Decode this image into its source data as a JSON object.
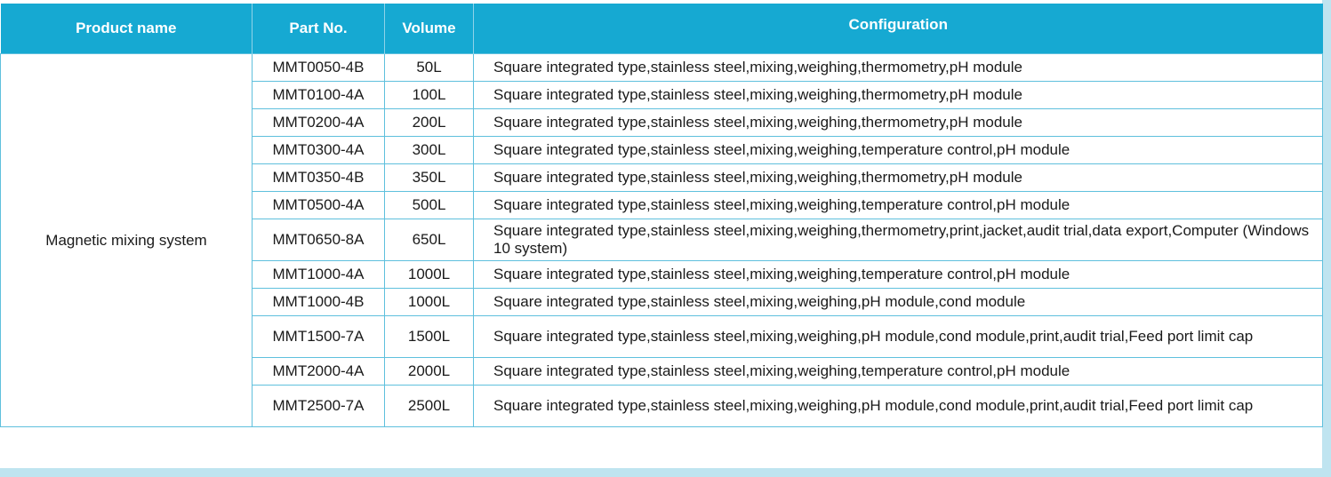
{
  "table": {
    "headers": [
      "Product name",
      "Part No.",
      "Volume",
      "Configuration"
    ],
    "product_name": "Magnetic mixing system",
    "rows": [
      {
        "part": "MMT0050-4B",
        "volume": "50L",
        "config": "Square integrated type,stainless steel,mixing,weighing,thermometry,pH module"
      },
      {
        "part": "MMT0100-4A",
        "volume": "100L",
        "config": "Square integrated type,stainless steel,mixing,weighing,thermometry,pH module"
      },
      {
        "part": "MMT0200-4A",
        "volume": "200L",
        "config": "Square integrated type,stainless steel,mixing,weighing,thermometry,pH module"
      },
      {
        "part": "MMT0300-4A",
        "volume": "300L",
        "config": "Square integrated type,stainless steel,mixing,weighing,temperature control,pH module"
      },
      {
        "part": "MMT0350-4B",
        "volume": "350L",
        "config": "Square integrated type,stainless steel,mixing,weighing,thermometry,pH module"
      },
      {
        "part": "MMT0500-4A",
        "volume": "500L",
        "config": "Square integrated type,stainless steel,mixing,weighing,temperature control,pH module"
      },
      {
        "part": "MMT0650-8A",
        "volume": "650L",
        "config": "Square integrated type,stainless steel,mixing,weighing,thermometry,print,jacket,audit trial,data export,Computer (Windows 10 system)"
      },
      {
        "part": "MMT1000-4A",
        "volume": "1000L",
        "config": "Square integrated type,stainless steel,mixing,weighing,temperature control,pH module"
      },
      {
        "part": "MMT1000-4B",
        "volume": "1000L",
        "config": "Square integrated type,stainless steel,mixing,weighing,pH module,cond module"
      },
      {
        "part": "MMT1500-7A",
        "volume": "1500L",
        "config": "Square integrated type,stainless steel,mixing,weighing,pH module,cond module,print,audit trial,Feed port limit cap"
      },
      {
        "part": "MMT2000-4A",
        "volume": "2000L",
        "config": "Square integrated type,stainless steel,mixing,weighing,temperature control,pH module"
      },
      {
        "part": "MMT2500-7A",
        "volume": "2500L",
        "config": "Square integrated type,stainless steel,mixing,weighing,pH module,cond module,print,audit trial,Feed port limit cap"
      }
    ]
  },
  "colors": {
    "header_bg": "#16a9d2",
    "header_text": "#ffffff",
    "grid": "#5fc0dd",
    "frame": "#bfe4f0"
  }
}
